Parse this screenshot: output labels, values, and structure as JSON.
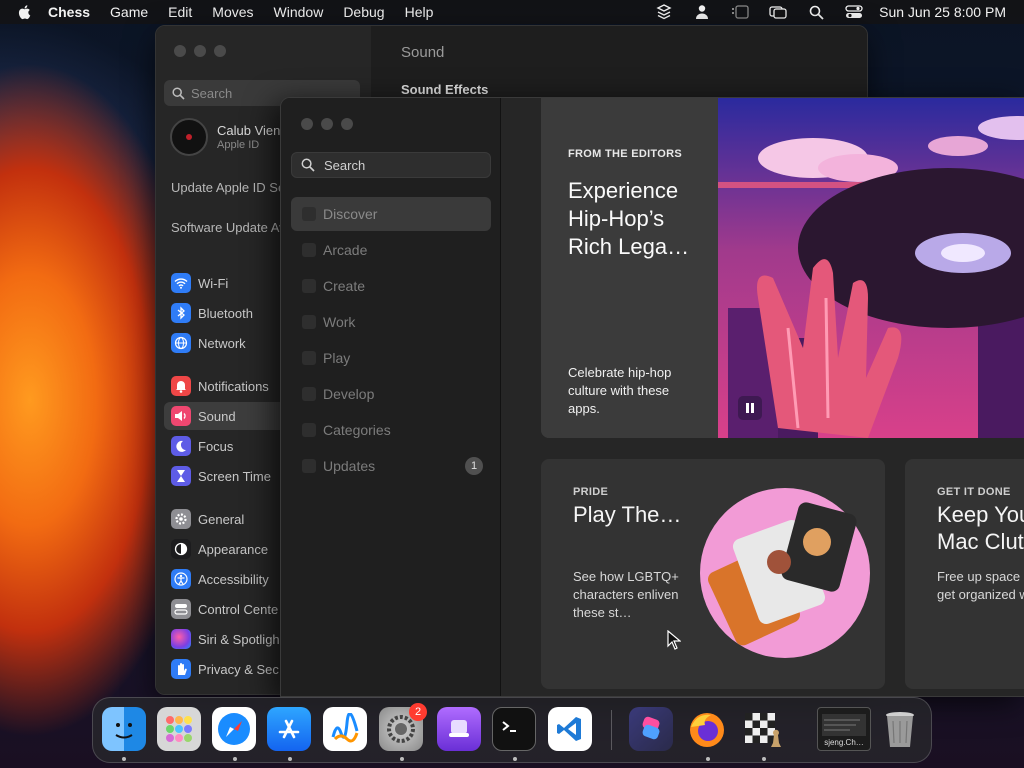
{
  "menubar": {
    "app_name": "Chess",
    "items": [
      "Game",
      "Edit",
      "Moves",
      "Window",
      "Debug",
      "Help"
    ],
    "clock": "Sun Jun 25  8:00 PM"
  },
  "settings_window": {
    "search_placeholder": "Search",
    "account": {
      "name": "Calub Vien",
      "subtitle": "Apple ID"
    },
    "notices": [
      "Update Apple ID Settings",
      "Software Update Available"
    ],
    "items": [
      {
        "label": "Wi-Fi",
        "icon": "wifi-icon",
        "color": "#2f7cf6"
      },
      {
        "label": "Bluetooth",
        "icon": "bluetooth-icon",
        "color": "#2f7cf6"
      },
      {
        "label": "Network",
        "icon": "globe-icon",
        "color": "#2f7cf6"
      },
      {
        "label": "Notifications",
        "icon": "bell-icon",
        "color": "#ef4747"
      },
      {
        "label": "Sound",
        "icon": "speaker-icon",
        "color": "#ef4770",
        "active": true
      },
      {
        "label": "Focus",
        "icon": "moon-icon",
        "color": "#5e5ce6"
      },
      {
        "label": "Screen Time",
        "icon": "hourglass-icon",
        "color": "#5e5ce6"
      },
      {
        "label": "General",
        "icon": "gear-icon",
        "color": "#8e8e93"
      },
      {
        "label": "Appearance",
        "icon": "appearance-icon",
        "color": "#1c1c1e"
      },
      {
        "label": "Accessibility",
        "icon": "accessibility-icon",
        "color": "#2f7cf6"
      },
      {
        "label": "Control Cente",
        "icon": "control-center-icon",
        "color": "#8e8e93"
      },
      {
        "label": "Siri & Spotligh",
        "icon": "siri-icon",
        "color": "#b14bd6"
      },
      {
        "label": "Privacy & Sec",
        "icon": "hand-icon",
        "color": "#2f7cf6"
      }
    ],
    "content_title": "Sound",
    "content_section": "Sound Effects"
  },
  "app_store": {
    "search_placeholder": "Search",
    "nav": [
      {
        "label": "Discover",
        "active": true
      },
      {
        "label": "Arcade"
      },
      {
        "label": "Create"
      },
      {
        "label": "Work"
      },
      {
        "label": "Play"
      },
      {
        "label": "Develop"
      },
      {
        "label": "Categories"
      },
      {
        "label": "Updates",
        "badge": "1"
      }
    ],
    "hero": {
      "eyebrow": "FROM THE EDITORS",
      "title": "Experience Hip-Hop’s Rich Lega…",
      "description": "Celebrate hip-hop culture with these apps."
    },
    "cards": [
      {
        "eyebrow": "PRIDE",
        "title": "Play The…",
        "description": "See how LGBTQ+ characters enliven these st…"
      },
      {
        "eyebrow": "GET IT DONE",
        "title": "Keep You Mac Clut",
        "description": "Free up space and get organized wi…"
      }
    ]
  },
  "dock": {
    "apps": [
      {
        "name": "finder-icon",
        "color": "#1e88e5"
      },
      {
        "name": "launchpad-icon",
        "color": "#d7d7d7"
      },
      {
        "name": "safari-icon",
        "color": "#ffffff"
      },
      {
        "name": "app-store-icon",
        "color": "#1a8cff"
      },
      {
        "name": "freeform-icon",
        "color": "#ffffff"
      },
      {
        "name": "system-settings-icon",
        "color": "#8e8e93",
        "badge": "2"
      },
      {
        "name": "podcasts-like-icon",
        "color": "#8a4fff"
      },
      {
        "name": "terminal-icon",
        "color": "#111111"
      },
      {
        "name": "vscode-icon",
        "color": "#ffffff"
      },
      {
        "name": "shortcuts-icon",
        "color": "#3a3a6a"
      },
      {
        "name": "firefox-icon",
        "color": "#ff7a1a"
      },
      {
        "name": "chess-icon",
        "color": "#e0e0e0"
      },
      {
        "name": "chess-window-thumbnail",
        "color": "#2a2a2a",
        "label": "sjeng.Ch…"
      },
      {
        "name": "trash-icon",
        "color": "#9a9a9a"
      }
    ]
  }
}
